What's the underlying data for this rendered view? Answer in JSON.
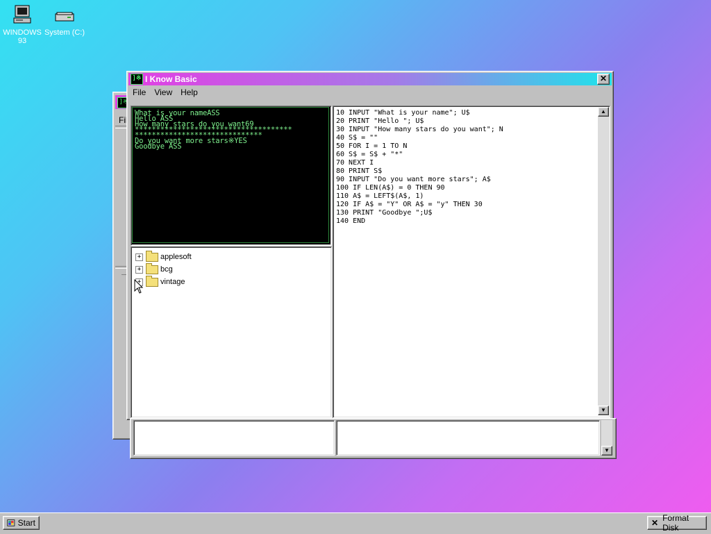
{
  "desktop": {
    "icons": [
      {
        "label_line1": "WINDOWS",
        "label_line2": "93",
        "icon": "computer-icon"
      },
      {
        "label_line1": "System (C:)",
        "label_line2": "",
        "icon": "drive-icon"
      }
    ]
  },
  "back_window": {
    "menu_partial": "Fil"
  },
  "main_window": {
    "title": "I Know Basic",
    "icon_glyph": "]※",
    "menu": [
      "File",
      "View",
      "Help"
    ],
    "console_lines": [
      "What is your nameASS",
      "Hello ASS",
      "How many stars do you want69",
      "*************************************",
      "******************************",
      "Do you want more stars※YES",
      "Goodbye ASS"
    ],
    "tree": [
      {
        "label": "applesoft"
      },
      {
        "label": "bcg"
      },
      {
        "label": "vintage"
      }
    ],
    "code_lines": [
      "10 INPUT \"What is your name\"; U$",
      "20 PRINT \"Hello \"; U$",
      "30 INPUT \"How many stars do you want\"; N",
      "40 S$ = \"\"",
      "50 FOR I = 1 TO N",
      "60 S$ = S$ + \"*\"",
      "70 NEXT I",
      "80 PRINT S$",
      "90 INPUT \"Do you want more stars\"; A$",
      "100 IF LEN(A$) = 0 THEN 90",
      "110 A$ = LEFT$(A$, 1)",
      "120 IF A$ = \"Y\" OR A$ = \"y\" THEN 30",
      "130 PRINT \"Goodbye \";U$",
      "140 END"
    ]
  },
  "taskbar": {
    "start_label": "Start",
    "format_label": "Format Disk"
  }
}
